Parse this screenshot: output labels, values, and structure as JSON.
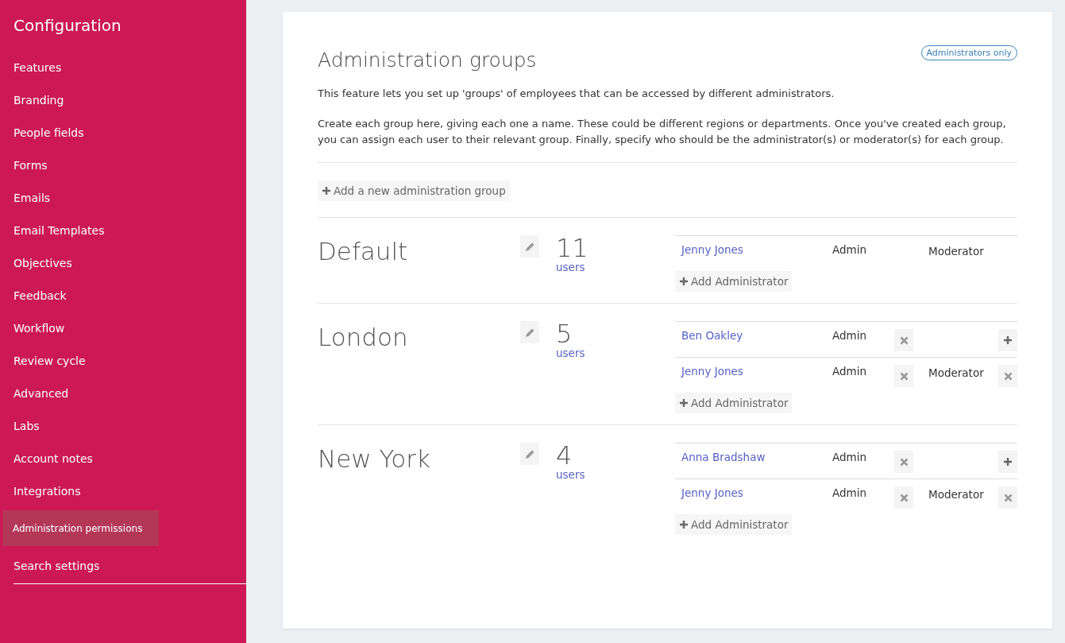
{
  "sidebar": {
    "title": "Configuration",
    "items": [
      {
        "label": "Features",
        "selected": false
      },
      {
        "label": "Branding",
        "selected": false
      },
      {
        "label": "People fields",
        "selected": false
      },
      {
        "label": "Forms",
        "selected": false
      },
      {
        "label": "Emails",
        "selected": false
      },
      {
        "label": "Email Templates",
        "selected": false
      },
      {
        "label": "Objectives",
        "selected": false
      },
      {
        "label": "Feedback",
        "selected": false
      },
      {
        "label": "Workflow",
        "selected": false
      },
      {
        "label": "Review cycle",
        "selected": false
      },
      {
        "label": "Advanced",
        "selected": false
      },
      {
        "label": "Labs",
        "selected": false
      },
      {
        "label": "Account notes",
        "selected": false
      },
      {
        "label": "Integrations",
        "selected": false
      },
      {
        "label": "Administration permissions",
        "selected": true
      },
      {
        "label": "Search settings",
        "selected": false
      }
    ]
  },
  "page": {
    "title": "Administration groups",
    "badge": "Administrators only",
    "paragraphs": [
      "This feature lets you set up 'groups' of employees that can be accessed by different administrators.",
      "Create each group here, giving each one a name. These could be different regions or departments. Once you've created each group, you can assign each user to their relevant group. Finally, specify who should be the administrator(s) or moderator(s) for each group."
    ],
    "add_group_button": "Add a new administration group"
  },
  "groups": [
    {
      "name": "Default",
      "count": "11",
      "count_label": "users",
      "add_button": "Add Administrator",
      "members": [
        {
          "name": "Jenny Jones",
          "admin": {
            "label": "Admin",
            "removable": false
          },
          "moderator": {
            "label": "Moderator",
            "removable": false
          },
          "can_add_moderator": false
        }
      ]
    },
    {
      "name": "London",
      "count": "5",
      "count_label": "users",
      "add_button": "Add Administrator",
      "members": [
        {
          "name": "Ben Oakley",
          "admin": {
            "label": "Admin",
            "removable": true
          },
          "can_add_moderator": true
        },
        {
          "name": "Jenny Jones",
          "admin": {
            "label": "Admin",
            "removable": true
          },
          "moderator": {
            "label": "Moderator",
            "removable": true
          },
          "can_add_moderator": false
        }
      ]
    },
    {
      "name": "New York",
      "count": "4",
      "count_label": "users",
      "add_button": "Add Administrator",
      "members": [
        {
          "name": "Anna Bradshaw",
          "admin": {
            "label": "Admin",
            "removable": true
          },
          "can_add_moderator": true
        },
        {
          "name": "Jenny Jones",
          "admin": {
            "label": "Admin",
            "removable": true
          },
          "moderator": {
            "label": "Moderator",
            "removable": true
          },
          "can_add_moderator": false
        }
      ]
    }
  ]
}
